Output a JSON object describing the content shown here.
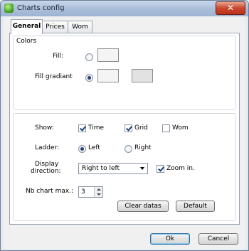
{
  "window": {
    "title": "Charts config",
    "close_symbol": "✕"
  },
  "tabs": [
    {
      "label": "General",
      "active": true
    },
    {
      "label": "Prices",
      "active": false
    },
    {
      "label": "Wom",
      "active": false
    }
  ],
  "colors_group": {
    "title": "Colors",
    "fill_label": "Fill:",
    "fill_selected": false,
    "fill_swatch_color": "#f4f4f4",
    "fill_gradiant_label": "Fill gradiant",
    "fill_gradiant_selected": true,
    "gradiant_swatch_1_color": "#f4f4f4",
    "gradiant_swatch_2_color": "#e2e2e2"
  },
  "display_group": {
    "show_label": "Show:",
    "show_options": [
      {
        "label": "Time",
        "checked": true
      },
      {
        "label": "Grid",
        "checked": true
      },
      {
        "label": "Wom",
        "checked": false
      }
    ],
    "ladder_label": "Ladder:",
    "ladder_options": [
      {
        "label": "Left",
        "selected": true
      },
      {
        "label": "Right",
        "selected": false
      }
    ],
    "display_direction_label_1": "Display",
    "display_direction_label_2": "direction:",
    "display_direction_value": "Right to left",
    "zoom_in_label": "Zoom in.",
    "zoom_in_checked": true,
    "nb_chart_max_label": "Nb chart max.:",
    "nb_chart_max_value": "3"
  },
  "buttons": {
    "clear_datas": "Clear datas",
    "default": "Default",
    "ok": "Ok",
    "cancel": "Cancel"
  },
  "theme": {
    "accent": "#1f3f7a",
    "close_red": "#c9462c"
  }
}
